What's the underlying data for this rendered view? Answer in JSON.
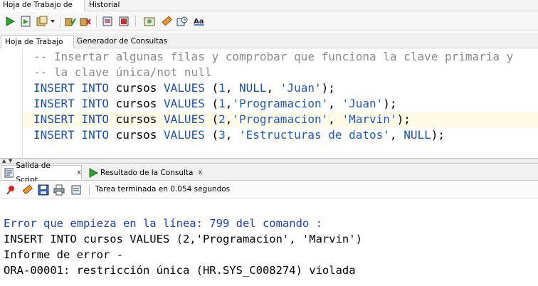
{
  "doc_tabs": [
    "Hoja de Trabajo de SQL",
    "Historial"
  ],
  "sub_tabs": [
    "Hoja de Trabajo",
    "Generador de Consultas"
  ],
  "editor": {
    "highlighted_line": 4,
    "lines": [
      [
        {
          "t": "-- Insertar algunas filas y comprobar que funciona la clave primaria y",
          "c": "cm"
        }
      ],
      [
        {
          "t": "-- la clave única/not null",
          "c": "cm"
        }
      ],
      [
        {
          "t": "INSERT INTO",
          "c": "kw"
        },
        {
          "t": " cursos ",
          "c": "tx"
        },
        {
          "t": "VALUES",
          "c": "kw"
        },
        {
          "t": " (",
          "c": "tx"
        },
        {
          "t": "1",
          "c": "nm"
        },
        {
          "t": ", ",
          "c": "tx"
        },
        {
          "t": "NULL",
          "c": "kw"
        },
        {
          "t": ", ",
          "c": "tx"
        },
        {
          "t": "'Juan'",
          "c": "st"
        },
        {
          "t": ");",
          "c": "tx"
        }
      ],
      [
        {
          "t": "INSERT INTO",
          "c": "kw"
        },
        {
          "t": " cursos ",
          "c": "tx"
        },
        {
          "t": "VALUES",
          "c": "kw"
        },
        {
          "t": " (",
          "c": "tx"
        },
        {
          "t": "1",
          "c": "nm"
        },
        {
          "t": ",",
          "c": "tx"
        },
        {
          "t": "'Programacion'",
          "c": "st"
        },
        {
          "t": ", ",
          "c": "tx"
        },
        {
          "t": "'Juan'",
          "c": "st"
        },
        {
          "t": ");",
          "c": "tx"
        }
      ],
      [
        {
          "t": "INSERT INTO",
          "c": "kw"
        },
        {
          "t": " cursos ",
          "c": "tx"
        },
        {
          "t": "VALUES",
          "c": "kw"
        },
        {
          "t": " (",
          "c": "tx"
        },
        {
          "t": "2",
          "c": "nm"
        },
        {
          "t": ",",
          "c": "tx"
        },
        {
          "t": "'Programacion'",
          "c": "st"
        },
        {
          "t": ", ",
          "c": "tx"
        },
        {
          "t": "'Marvin'",
          "c": "st"
        },
        {
          "t": ");",
          "c": "tx"
        }
      ],
      [
        {
          "t": "INSERT INTO",
          "c": "kw"
        },
        {
          "t": " cursos ",
          "c": "tx"
        },
        {
          "t": "VALUES",
          "c": "kw"
        },
        {
          "t": " (",
          "c": "tx"
        },
        {
          "t": "3",
          "c": "nm"
        },
        {
          "t": ", ",
          "c": "tx"
        },
        {
          "t": "'Estructuras de datos'",
          "c": "st"
        },
        {
          "t": ", ",
          "c": "tx"
        },
        {
          "t": "NULL",
          "c": "kw"
        },
        {
          "t": ");",
          "c": "tx"
        }
      ]
    ]
  },
  "output_tabs": {
    "script_output": "Salida de Script",
    "query_result": "Resultado de la Consulta",
    "close_glyph": "x"
  },
  "output_toolbar": {
    "status": "Tarea terminada en 0.054 segundos"
  },
  "output": {
    "error_line": "Error que empieza en la línea: 799 del comando :",
    "statement": "INSERT INTO cursos VALUES (2,'Programacion', 'Marvin')",
    "report": "Informe de error -",
    "message": "ORA-00001: restricción única (HR.SYS_C008274) violada"
  },
  "colors": {
    "keyword": "#1a4fb8",
    "string": "#1d59c9",
    "comment": "#8a8a8a",
    "error_text": "#1a3fd0",
    "current_line": "#fdfbe6"
  },
  "icons": [
    "run-statement-icon",
    "run-script-icon",
    "commit-icon",
    "rollback-icon",
    "autotrace-icon",
    "explain-plan-icon",
    "sql-tuning-icon",
    "clear-icon",
    "history-icon",
    "format-icon",
    "pin-icon",
    "eraser-icon",
    "save-icon",
    "print-icon",
    "open-file-icon"
  ]
}
